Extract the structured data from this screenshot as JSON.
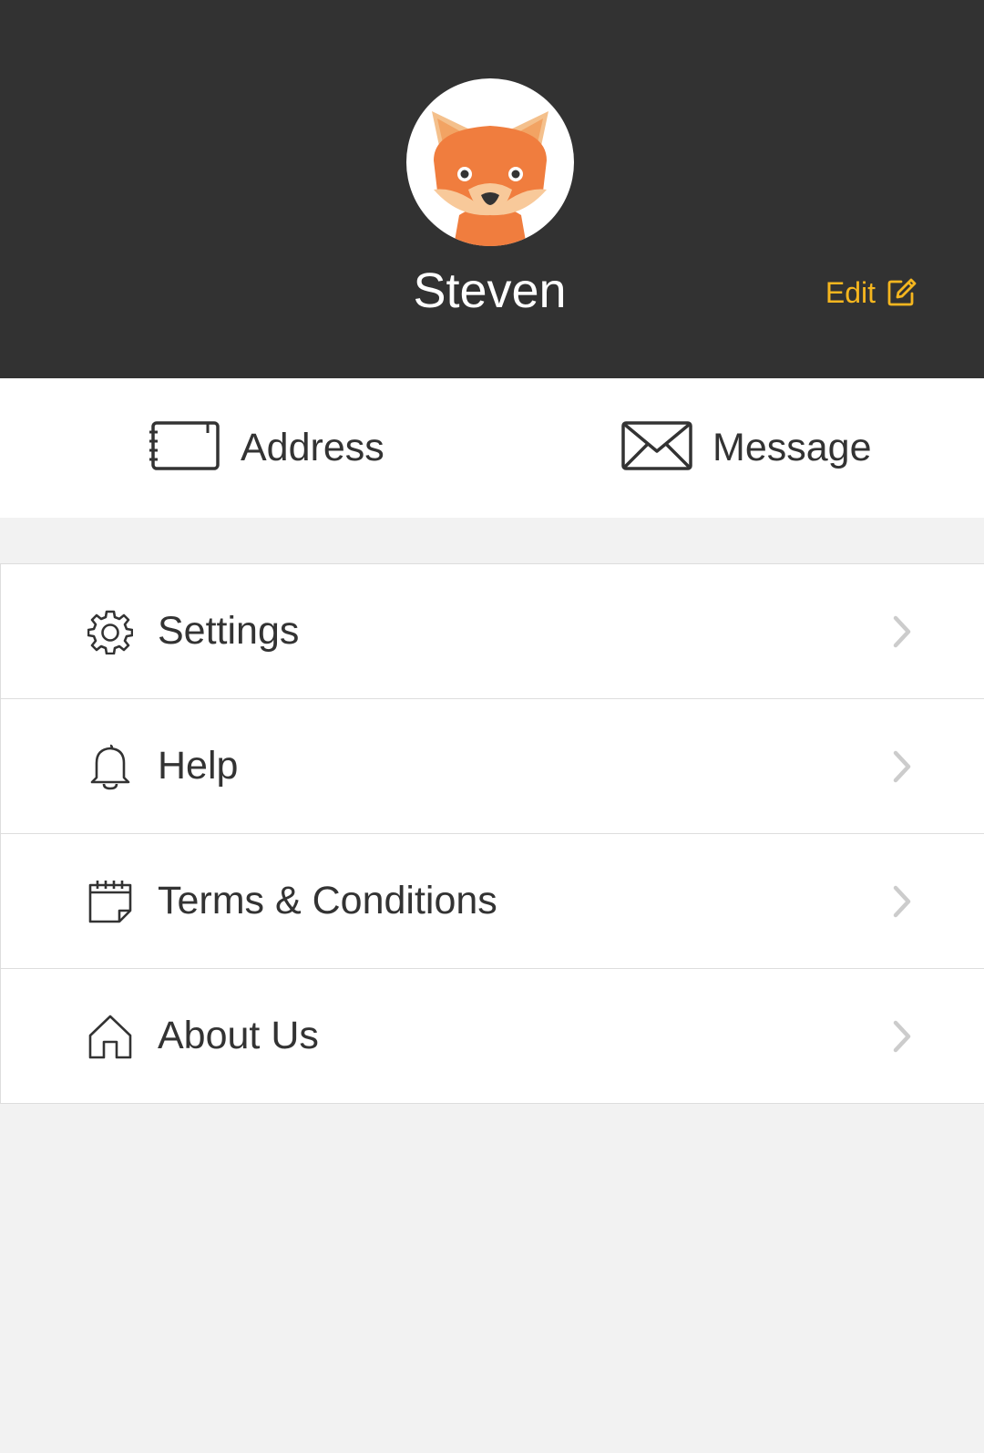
{
  "profile": {
    "avatar_icon": "fox-avatar-icon",
    "name": "Steven",
    "edit_label": "Edit",
    "edit_icon": "edit-icon",
    "accent_color": "#f5b61f",
    "header_color": "#323232"
  },
  "quick_actions": [
    {
      "label": "Address",
      "icon": "address-book-icon"
    },
    {
      "label": "Message",
      "icon": "envelope-icon"
    }
  ],
  "menu": [
    {
      "label": "Settings",
      "icon": "gear-icon"
    },
    {
      "label": "Help",
      "icon": "bell-icon"
    },
    {
      "label": "Terms & Conditions",
      "icon": "calendar-note-icon"
    },
    {
      "label": "About Us",
      "icon": "home-icon"
    }
  ]
}
